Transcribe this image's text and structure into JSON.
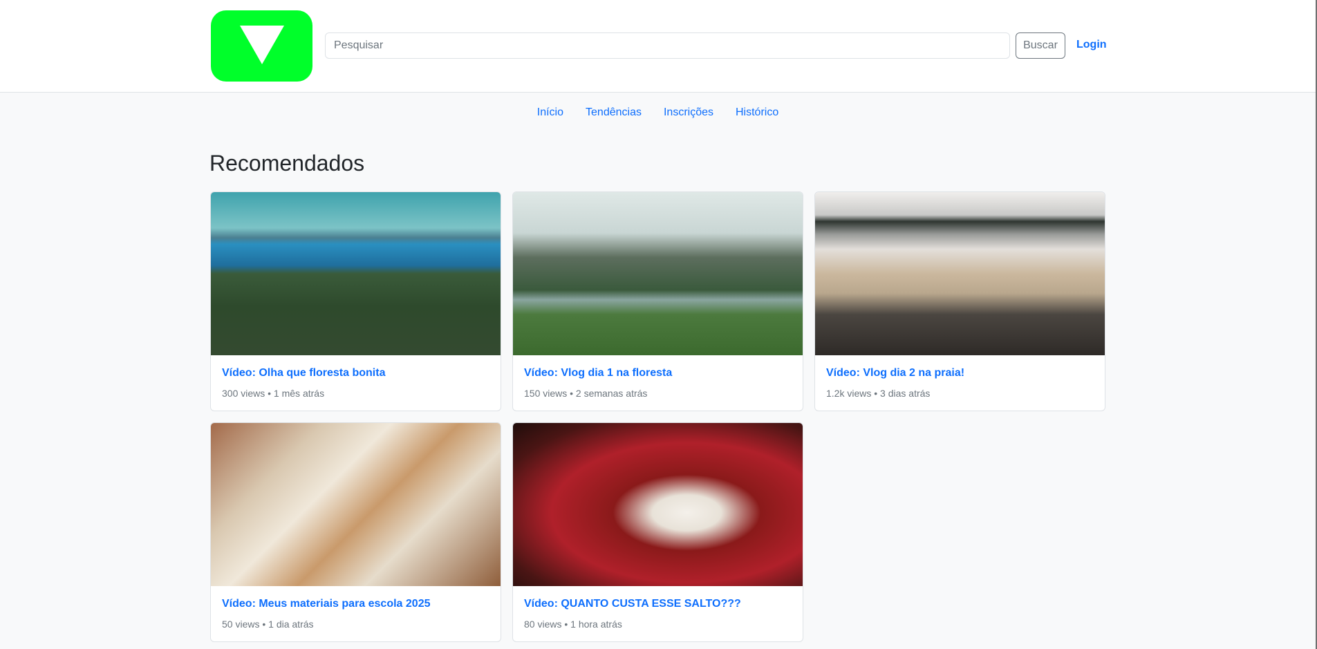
{
  "header": {
    "logo_alt": "play-triangle-logo",
    "search": {
      "placeholder": "Pesquisar",
      "value": ""
    },
    "search_button_label": "Buscar",
    "login_label": "Login"
  },
  "nav": {
    "items": [
      {
        "label": "Início"
      },
      {
        "label": "Tendências"
      },
      {
        "label": "Inscrições"
      },
      {
        "label": "Histórico"
      }
    ]
  },
  "main": {
    "section_title": "Recomendados",
    "videos": [
      {
        "title": "Vídeo: Olha que floresta bonita",
        "meta": "300 views • 1 mês atrás"
      },
      {
        "title": "Vídeo: Vlog dia 1 na floresta",
        "meta": "150 views • 2 semanas atrás"
      },
      {
        "title": "Vídeo: Vlog dia 2 na praia!",
        "meta": "1.2k views • 3 dias atrás"
      },
      {
        "title": "Vídeo: Meus materiais para escola 2025",
        "meta": "50 views • 1 dia atrás"
      },
      {
        "title": "Vídeo: QUANTO CUSTA ESSE SALTO???",
        "meta": "80 views • 1 hora atrás"
      }
    ]
  },
  "colors": {
    "brand": "#00ff2a",
    "link": "#0d6efd",
    "background": "#f8f9fa"
  }
}
